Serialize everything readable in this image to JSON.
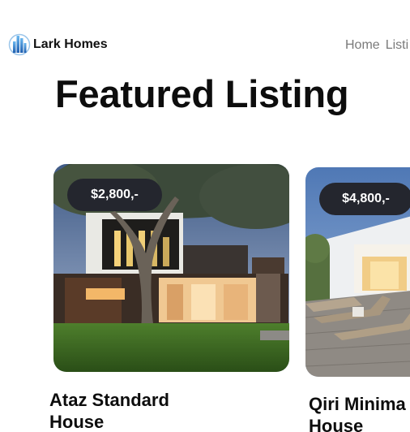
{
  "header": {
    "brand_name": "Lark Homes",
    "logo_icon": "building-logo-icon",
    "nav": [
      {
        "label": "Home"
      },
      {
        "label": "Listi"
      }
    ]
  },
  "main": {
    "title": "Featured Listing",
    "listings": [
      {
        "price": "$2,800,-",
        "name_line1": "Ataz Standard",
        "name_line2": "House",
        "photo": "modern-house-photo"
      },
      {
        "price": "$4,800,-",
        "name_line1": "Qiri Minima",
        "name_line2": "House",
        "photo": "pool-deck-photo"
      }
    ]
  },
  "colors": {
    "price_badge_bg": "#24262e",
    "nav_text": "#7a7a7a",
    "logo_blue": "#2f7fd1"
  }
}
